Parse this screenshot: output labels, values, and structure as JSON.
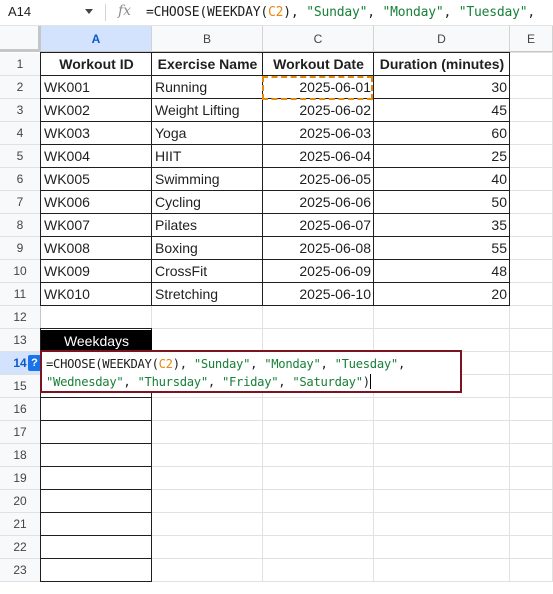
{
  "formula_bar": {
    "cell_ref": "A14",
    "fx_label": "fx",
    "formula_parts": [
      {
        "t": "=CHOOSE(WEEKDAY(",
        "k": "plain"
      },
      {
        "t": "C2",
        "k": "ref"
      },
      {
        "t": "), ",
        "k": "plain"
      },
      {
        "t": "\"Sunday\"",
        "k": "str"
      },
      {
        "t": ", ",
        "k": "plain"
      },
      {
        "t": "\"Monday\"",
        "k": "str"
      },
      {
        "t": ", ",
        "k": "plain"
      },
      {
        "t": "\"Tuesday\"",
        "k": "str"
      },
      {
        "t": ",",
        "k": "plain"
      }
    ]
  },
  "columns": [
    "A",
    "B",
    "C",
    "D",
    "E"
  ],
  "selected_column": "A",
  "rows": [
    "1",
    "2",
    "3",
    "4",
    "5",
    "6",
    "7",
    "8",
    "9",
    "10",
    "11",
    "12",
    "13",
    "14",
    "15",
    "16",
    "17",
    "18",
    "19",
    "20",
    "21",
    "22",
    "23"
  ],
  "selected_row": "14",
  "table": {
    "headers": [
      "Workout ID",
      "Exercise Name",
      "Workout Date",
      "Duration (minutes)"
    ],
    "rows": [
      [
        "WK001",
        "Running",
        "2025-06-01",
        "30"
      ],
      [
        "WK002",
        "Weight Lifting",
        "2025-06-02",
        "45"
      ],
      [
        "WK003",
        "Yoga",
        "2025-06-03",
        "60"
      ],
      [
        "WK004",
        "HIIT",
        "2025-06-04",
        "25"
      ],
      [
        "WK005",
        "Swimming",
        "2025-06-05",
        "40"
      ],
      [
        "WK006",
        "Cycling",
        "2025-06-06",
        "50"
      ],
      [
        "WK007",
        "Pilates",
        "2025-06-07",
        "35"
      ],
      [
        "WK008",
        "Boxing",
        "2025-06-08",
        "55"
      ],
      [
        "WK009",
        "CrossFit",
        "2025-06-09",
        "48"
      ],
      [
        "WK010",
        "Stretching",
        "2025-06-10",
        "20"
      ]
    ]
  },
  "weekdays_header": "Weekdays",
  "editor": {
    "help_badge": "?",
    "line1": [
      {
        "t": "=CHOOSE(WEEKDAY(",
        "k": "plain"
      },
      {
        "t": "C2",
        "k": "ref"
      },
      {
        "t": "), ",
        "k": "plain"
      },
      {
        "t": "\"Sunday\"",
        "k": "str"
      },
      {
        "t": ", ",
        "k": "plain"
      },
      {
        "t": "\"Monday\"",
        "k": "str"
      },
      {
        "t": ", ",
        "k": "plain"
      },
      {
        "t": "\"Tuesday\"",
        "k": "str"
      },
      {
        "t": ",",
        "k": "plain"
      }
    ],
    "line2": [
      {
        "t": "\"Wednesday\"",
        "k": "str"
      },
      {
        "t": ", ",
        "k": "plain"
      },
      {
        "t": "\"Thursday\"",
        "k": "str"
      },
      {
        "t": ", ",
        "k": "plain"
      },
      {
        "t": "\"Friday\"",
        "k": "str"
      },
      {
        "t": ", ",
        "k": "plain"
      },
      {
        "t": "\"Saturday\"",
        "k": "str"
      },
      {
        "t": ")",
        "k": "plain"
      }
    ]
  },
  "colors": {
    "selection_bg": "#d3e3fd",
    "selection_text": "#0b57d0",
    "ref_color": "#e8880f",
    "string_color": "#188038",
    "editor_border": "#7c1320"
  }
}
